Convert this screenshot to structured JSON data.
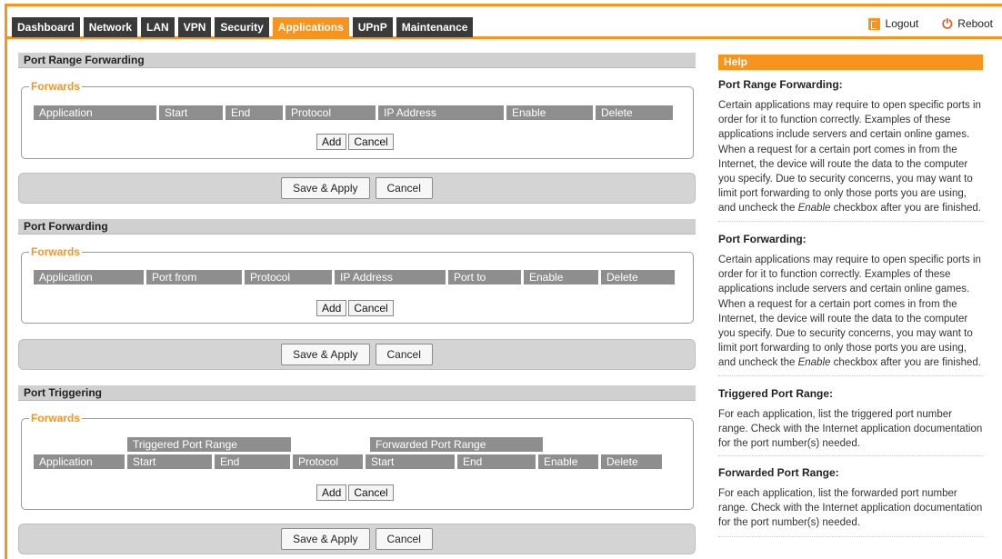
{
  "nav": {
    "tabs": [
      {
        "label": "Dashboard"
      },
      {
        "label": "Network"
      },
      {
        "label": "LAN"
      },
      {
        "label": "VPN"
      },
      {
        "label": "Security"
      },
      {
        "label": "Applications",
        "active": true
      },
      {
        "label": "UPnP"
      },
      {
        "label": "Maintenance"
      }
    ],
    "logout_label": "Logout",
    "reboot_label": "Reboot"
  },
  "colors": {
    "accent": "#f7941d",
    "tab_bg": "#3a3a3a",
    "header_cell": "#8e8e8e"
  },
  "sections": {
    "range_forwarding": {
      "title": "Port Range Forwarding",
      "legend": "Forwards",
      "columns": [
        "Application",
        "Start",
        "End",
        "Protocol",
        "IP Address",
        "Enable",
        "Delete"
      ],
      "add_label": "Add",
      "cancel_label": "Cancel",
      "save_label": "Save & Apply",
      "bar_cancel_label": "Cancel"
    },
    "port_forwarding": {
      "title": "Port Forwarding",
      "legend": "Forwards",
      "columns": [
        "Application",
        "Port from",
        "Protocol",
        "IP Address",
        "Port to",
        "Enable",
        "Delete"
      ],
      "add_label": "Add",
      "cancel_label": "Cancel",
      "save_label": "Save & Apply",
      "bar_cancel_label": "Cancel"
    },
    "port_triggering": {
      "title": "Port Triggering",
      "legend": "Forwards",
      "group_triggered": "Triggered Port Range",
      "group_forwarded": "Forwarded Port Range",
      "columns": [
        "Application",
        "Start",
        "End",
        "Protocol",
        "Start",
        "End",
        "Enable",
        "Delete"
      ],
      "add_label": "Add",
      "cancel_label": "Cancel",
      "save_label": "Save & Apply",
      "bar_cancel_label": "Cancel"
    }
  },
  "help": {
    "title": "Help",
    "items": [
      {
        "heading": "Port Range Forwarding:",
        "text": "Certain applications may require to open specific ports in order for it to function correctly. Examples of these applications include servers and certain online games. When a request for a certain port comes in from the Internet, the device will route the data to the computer you specify. Due to security concerns, you may want to limit port forwarding to only those ports you are using, and uncheck the ",
        "em": "Enable",
        "tail": " checkbox after you are finished."
      },
      {
        "heading": "Port Forwarding:",
        "text": "Certain applications may require to open specific ports in order for it to function correctly. Examples of these applications include servers and certain online games. When a request for a certain port comes in from the Internet, the device will route the data to the computer you specify. Due to security concerns, you may want to limit port forwarding to only those ports you are using, and uncheck the ",
        "em": "Enable",
        "tail": " checkbox after you are finished."
      },
      {
        "heading": "Triggered Port Range:",
        "text": "For each application, list the triggered port number range. Check with the Internet application documentation for the port number(s) needed."
      },
      {
        "heading": "Forwarded Port Range:",
        "text": "For each application, list the forwarded port number range. Check with the Internet application documentation for the port number(s) needed."
      }
    ]
  }
}
